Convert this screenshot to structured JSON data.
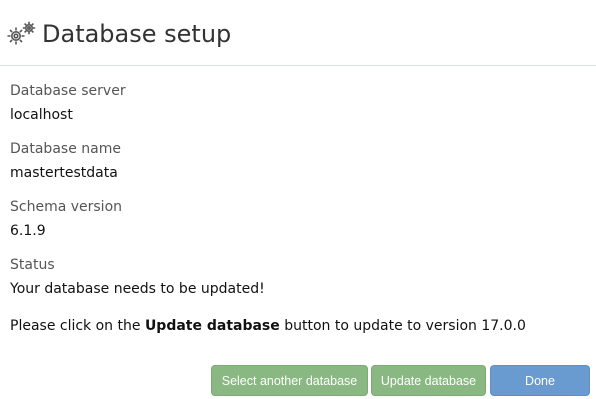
{
  "header": {
    "title": "Database setup",
    "icon": "gears-icon"
  },
  "fields": {
    "server_label": "Database server",
    "server_value": "localhost",
    "name_label": "Database name",
    "name_value": "mastertestdata",
    "schema_label": "Schema version",
    "schema_value": "6.1.9",
    "status_label": "Status",
    "status_value": "Your database needs to be updated!"
  },
  "note": {
    "prefix": "Please click on the ",
    "emphasis": "Update database",
    "suffix": " button to update to version 17.0.0"
  },
  "buttons": {
    "select_label": "Select another database",
    "update_label": "Update database",
    "done_label": "Done"
  },
  "colors": {
    "green_button": "#89b882",
    "blue_button": "#6a9bd0",
    "divider": "#d9e3ea"
  }
}
